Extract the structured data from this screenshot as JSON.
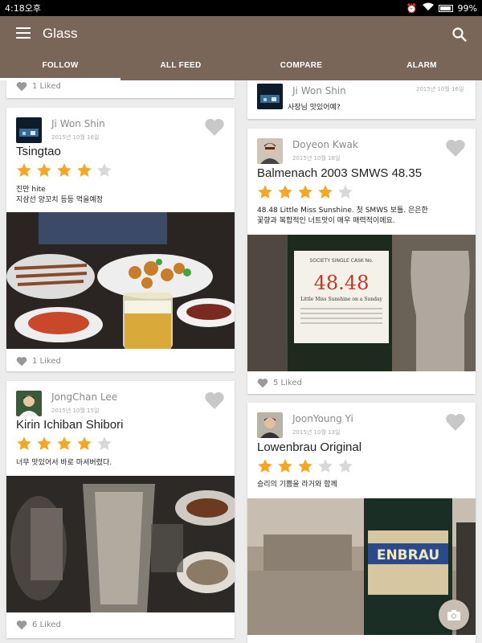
{
  "status_bar": {
    "time": "4:18오후",
    "battery": "99%"
  },
  "app": {
    "title": "Glass"
  },
  "tabs": [
    {
      "label": "FOLLOW",
      "active": true
    },
    {
      "label": "ALL FEED",
      "active": false
    },
    {
      "label": "COMPARE",
      "active": false
    },
    {
      "label": "ALARM",
      "active": false
    }
  ],
  "partial_top_left": {
    "liked": "1 Liked"
  },
  "partial_top_right": {
    "author": "Ji Won Shin",
    "date": "2015년 10월 16일",
    "comment": "사장님 맛있어예?"
  },
  "posts": [
    {
      "author": "Ji Won Shin",
      "date": "2015년 10월 16일",
      "beer": "Tsingtao",
      "rating": 4,
      "comment_lines": [
        "진만 hite",
        "지삼선 양꼬치 등등 먹을예정"
      ],
      "liked": "1 Liked"
    },
    {
      "author": "Doyeon Kwak",
      "date": "2015년 10월 16일",
      "beer": "Balmenach 2003 SMWS 48.35",
      "rating": 4,
      "comment_lines": [
        "48.48 Little Miss Sunshine. 첫 SMWS 보틀. 은은한",
        "꽃향과 복합적인 너트맛이 매우 매력적이에요."
      ],
      "liked": "5 Liked",
      "label": {
        "top": "SOCIETY SINGLE CASK No.",
        "code": "48.48",
        "name": "Little Miss Sunshine on a Sunday"
      }
    },
    {
      "author": "JongChan Lee",
      "date": "2015년 10월 15일",
      "beer": "Kirin Ichiban Shibori",
      "rating": 4,
      "comment_lines": [
        "너무 맛있어서 바로 마셔버렸다."
      ],
      "liked": "6 Liked"
    },
    {
      "author": "JoonYoung Yi",
      "date": "2015년 10월 13일",
      "beer": "Lowenbrau Original",
      "rating": 3,
      "comment_lines": [
        "승리의 기쁨을 라거와 함께"
      ],
      "liked": "",
      "label": {
        "brand": "ENBRAU"
      }
    }
  ],
  "colors": {
    "appbar": "#7a6658",
    "star_on": "#f5a623",
    "star_off": "#d8d8d8",
    "heart": "#c8c8c8"
  }
}
